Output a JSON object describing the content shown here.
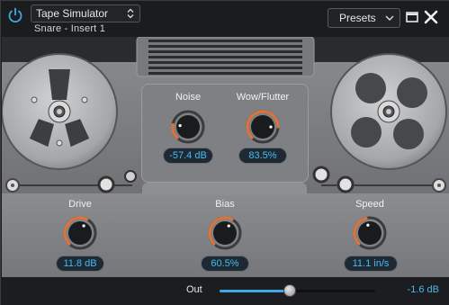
{
  "plugin": {
    "name": "Tape Simulator",
    "insert": "Snare - Insert 1"
  },
  "header": {
    "presets_label": "Presets"
  },
  "controls": {
    "noise": {
      "label": "Noise",
      "value": "-57.4 dB",
      "level": 0.2
    },
    "wow_flutter": {
      "label": "Wow/Flutter",
      "value": "83.5%",
      "level": 0.835
    },
    "drive": {
      "label": "Drive",
      "value": "11.8 dB",
      "level": 0.6
    },
    "bias": {
      "label": "Bias",
      "value": "60.5%",
      "level": 0.605
    },
    "speed": {
      "label": "Speed",
      "value": "11.1 in/s",
      "level": 0.45
    }
  },
  "output": {
    "label": "Out",
    "value": "-1.6 dB",
    "level": 0.45
  },
  "colors": {
    "accent_blue": "#3fa8e0",
    "readout_text": "#49b8f0",
    "knob_arc": "#e0733a",
    "panel_gray": "#8a8c8f"
  },
  "icons": {
    "power": "power-icon",
    "select_chevron": "updown-chevron-icon",
    "presets_chevron": "chevron-down-icon",
    "window": "window-icon",
    "close": "close-icon"
  }
}
